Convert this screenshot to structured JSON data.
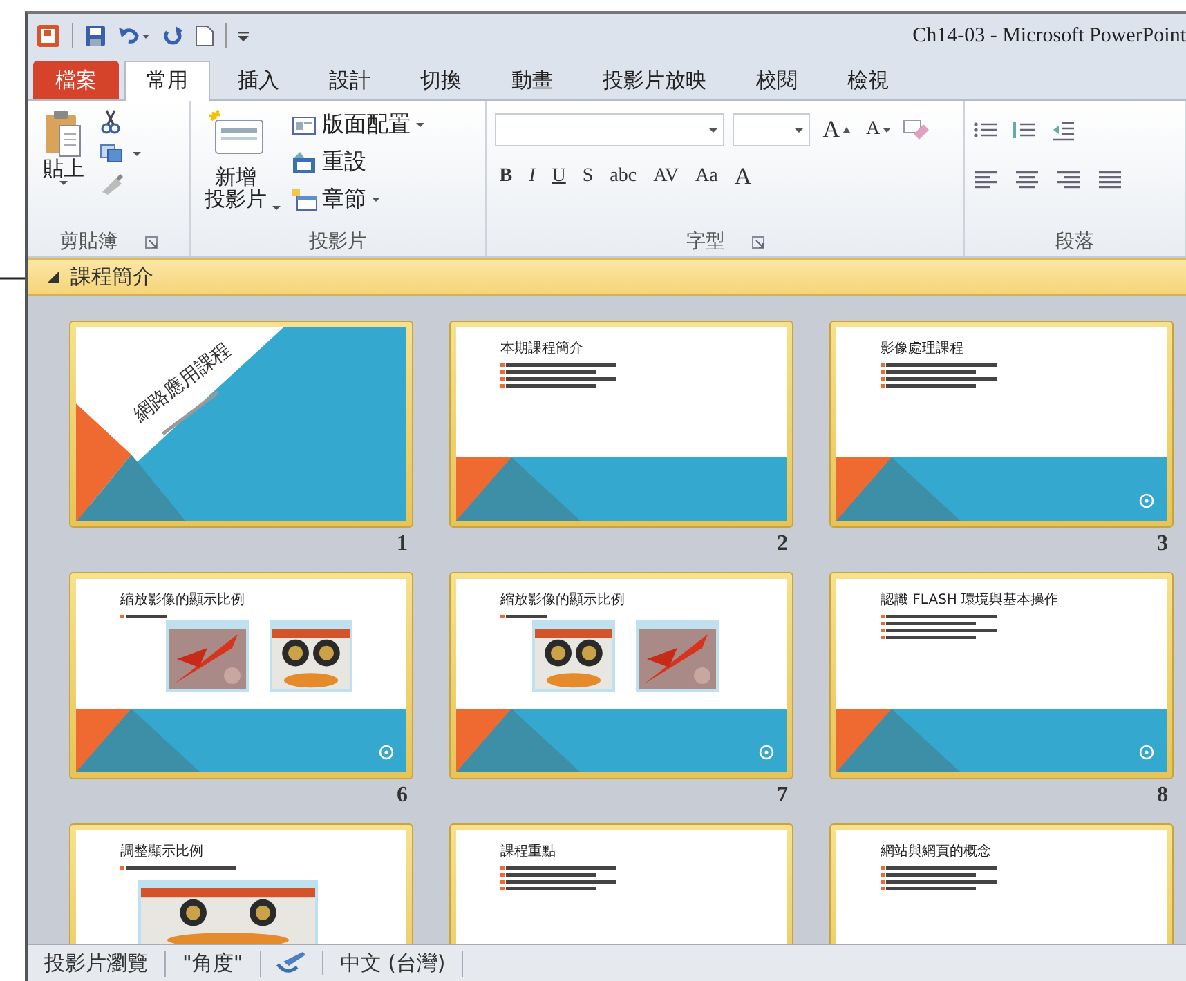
{
  "window": {
    "title": "Ch14-03 - Microsoft PowerPoint"
  },
  "tabs": [
    {
      "label": "檔案",
      "kind": "file",
      "selected": false
    },
    {
      "label": "常用",
      "kind": "tab",
      "selected": true
    },
    {
      "label": "插入",
      "kind": "tab",
      "selected": false
    },
    {
      "label": "設計",
      "kind": "tab",
      "selected": false
    },
    {
      "label": "切換",
      "kind": "tab",
      "selected": false
    },
    {
      "label": "動畫",
      "kind": "tab",
      "selected": false
    },
    {
      "label": "投影片放映",
      "kind": "tab",
      "selected": false
    },
    {
      "label": "校閱",
      "kind": "tab",
      "selected": false
    },
    {
      "label": "檢視",
      "kind": "tab",
      "selected": false
    }
  ],
  "ribbon": {
    "clipboard": {
      "label": "剪貼簿",
      "paste": "貼上"
    },
    "slides": {
      "label": "投影片",
      "new_slide": [
        "新增",
        "投影片"
      ],
      "items": [
        {
          "label": "版面配置",
          "dropdown": true
        },
        {
          "label": "重設",
          "dropdown": false
        },
        {
          "label": "章節",
          "dropdown": true
        }
      ]
    },
    "font": {
      "label": "字型",
      "grow": "A",
      "shrink": "A",
      "styles": [
        "B",
        "I",
        "U",
        "S",
        "abc"
      ],
      "spacing": "AV",
      "case": "Aa",
      "font_color_button": "A"
    },
    "paragraph": {
      "label": "段落"
    }
  },
  "section": {
    "title": "課程簡介",
    "expanded": true
  },
  "slides": [
    {
      "kind": "title",
      "title": "網路應用課程",
      "number": "1",
      "selected": true,
      "footer_icon": false
    },
    {
      "kind": "bullets",
      "title": "本期課程簡介",
      "number": "2",
      "selected": true,
      "footer_icon": false
    },
    {
      "kind": "bullets",
      "title": "影像處理課程",
      "number": "3",
      "selected": true,
      "footer_icon": true
    },
    {
      "kind": "two_pictures",
      "title": "縮放影像的顯示比例",
      "number": "6",
      "selected": true,
      "footer_icon": true
    },
    {
      "kind": "two_pictures",
      "title": "縮放影像的顯示比例",
      "number": "7",
      "selected": true,
      "footer_icon": true
    },
    {
      "kind": "bullets",
      "title": "認識 FLASH 環境與基本操作",
      "number": "8",
      "selected": true,
      "footer_icon": true
    },
    {
      "kind": "picture",
      "title": "調整顯示比例",
      "selected": true,
      "footer_icon": false
    },
    {
      "kind": "bullets",
      "title": "課程重點",
      "selected": true,
      "footer_icon": false
    },
    {
      "kind": "bullets",
      "title": "網站與網頁的概念",
      "selected": true,
      "footer_icon": false
    }
  ],
  "status_bar": {
    "view": "投影片瀏覽",
    "theme": "\"角度\"",
    "language": "中文 (台灣)"
  }
}
